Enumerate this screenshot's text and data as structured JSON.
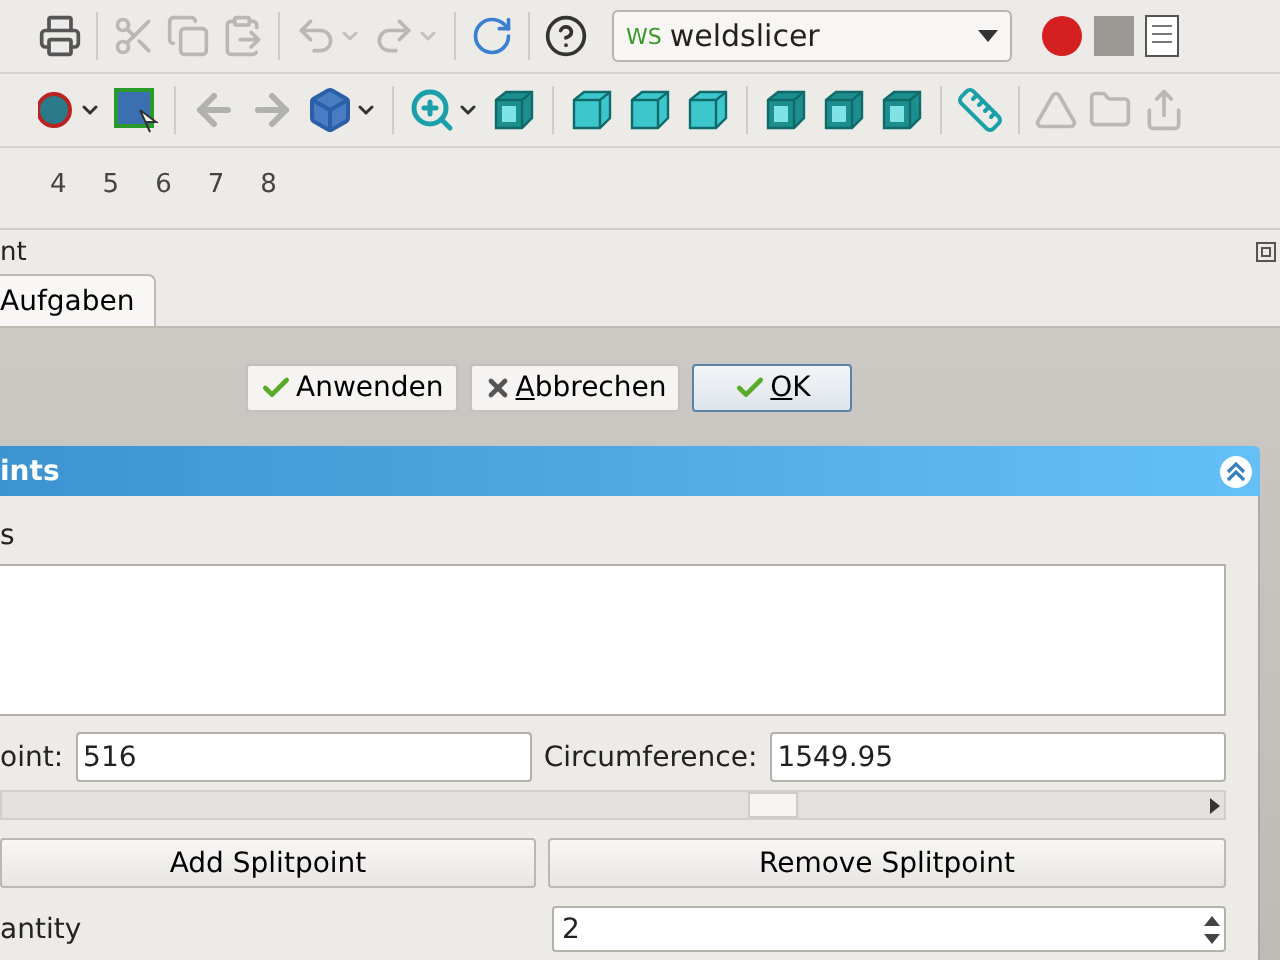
{
  "toolbar_1": [
    {
      "kind": "print",
      "disabled": false,
      "caret": false
    },
    {
      "kind": "separator"
    },
    {
      "kind": "cut",
      "disabled": true,
      "caret": false
    },
    {
      "kind": "copy",
      "disabled": true,
      "caret": false
    },
    {
      "kind": "paste",
      "disabled": true,
      "caret": false
    },
    {
      "kind": "separator"
    },
    {
      "kind": "undo",
      "disabled": true,
      "caret": true
    },
    {
      "kind": "redo",
      "disabled": true,
      "caret": true
    },
    {
      "kind": "separator"
    },
    {
      "kind": "refresh",
      "disabled": false,
      "caret": false
    },
    {
      "kind": "separator"
    },
    {
      "kind": "help",
      "disabled": false,
      "caret": false
    }
  ],
  "workbench": {
    "badge": "WS",
    "value": "weldslicer"
  },
  "toolbar_1_end": [
    {
      "kind": "record",
      "disabled": false,
      "caret": false
    },
    {
      "kind": "stop",
      "disabled": false,
      "caret": false
    },
    {
      "kind": "macro",
      "disabled": false,
      "caret": false
    }
  ],
  "toolbar_2": [
    {
      "kind": "sphere",
      "disabled": false,
      "caret": true
    },
    {
      "kind": "boxselect",
      "disabled": false,
      "caret": false
    },
    {
      "kind": "separator"
    },
    {
      "kind": "back",
      "disabled": true,
      "caret": false
    },
    {
      "kind": "forward",
      "disabled": true,
      "caret": false
    },
    {
      "kind": "part",
      "disabled": false,
      "caret": true
    },
    {
      "kind": "separator"
    },
    {
      "kind": "zoom",
      "disabled": false,
      "caret": true
    },
    {
      "kind": "cube-iso",
      "disabled": false,
      "caret": false
    },
    {
      "kind": "separator"
    },
    {
      "kind": "cube-front",
      "disabled": false,
      "caret": false
    },
    {
      "kind": "cube-top",
      "disabled": false,
      "caret": false
    },
    {
      "kind": "cube-right",
      "disabled": false,
      "caret": false
    },
    {
      "kind": "separator"
    },
    {
      "kind": "cube-rear",
      "disabled": false,
      "caret": false
    },
    {
      "kind": "cube-bottom",
      "disabled": false,
      "caret": false
    },
    {
      "kind": "cube-left",
      "disabled": false,
      "caret": false
    },
    {
      "kind": "separator"
    },
    {
      "kind": "ruler",
      "disabled": false,
      "caret": false
    },
    {
      "kind": "separator"
    },
    {
      "kind": "shape",
      "disabled": true,
      "caret": false
    },
    {
      "kind": "folder",
      "disabled": true,
      "caret": false
    },
    {
      "kind": "share",
      "disabled": true,
      "caret": false
    }
  ],
  "views": [
    "4",
    "5",
    "6",
    "7",
    "8"
  ],
  "panel": {
    "title": "nt"
  },
  "tabs": [
    {
      "label": "Aufgaben",
      "selected": true
    }
  ],
  "actions": [
    {
      "kind": "apply",
      "label": "Anwenden",
      "default": false
    },
    {
      "kind": "cancel",
      "label": "bbrechen",
      "mnemonic": "A",
      "default": false
    },
    {
      "kind": "ok",
      "label": "K",
      "mnemonic": "O",
      "default": true
    }
  ],
  "section": {
    "title": "ints",
    "expanded": true,
    "list_label": "s",
    "point_label": "oint:",
    "point_value": "516",
    "circumference_label": "Circumference:",
    "circumference_value": "1549.95",
    "slider": {
      "level": 0.63
    },
    "buttons": [
      "Add Splitpoint",
      "Remove Splitpoint"
    ],
    "quantity_label": "antity",
    "quantity_value": "2"
  }
}
